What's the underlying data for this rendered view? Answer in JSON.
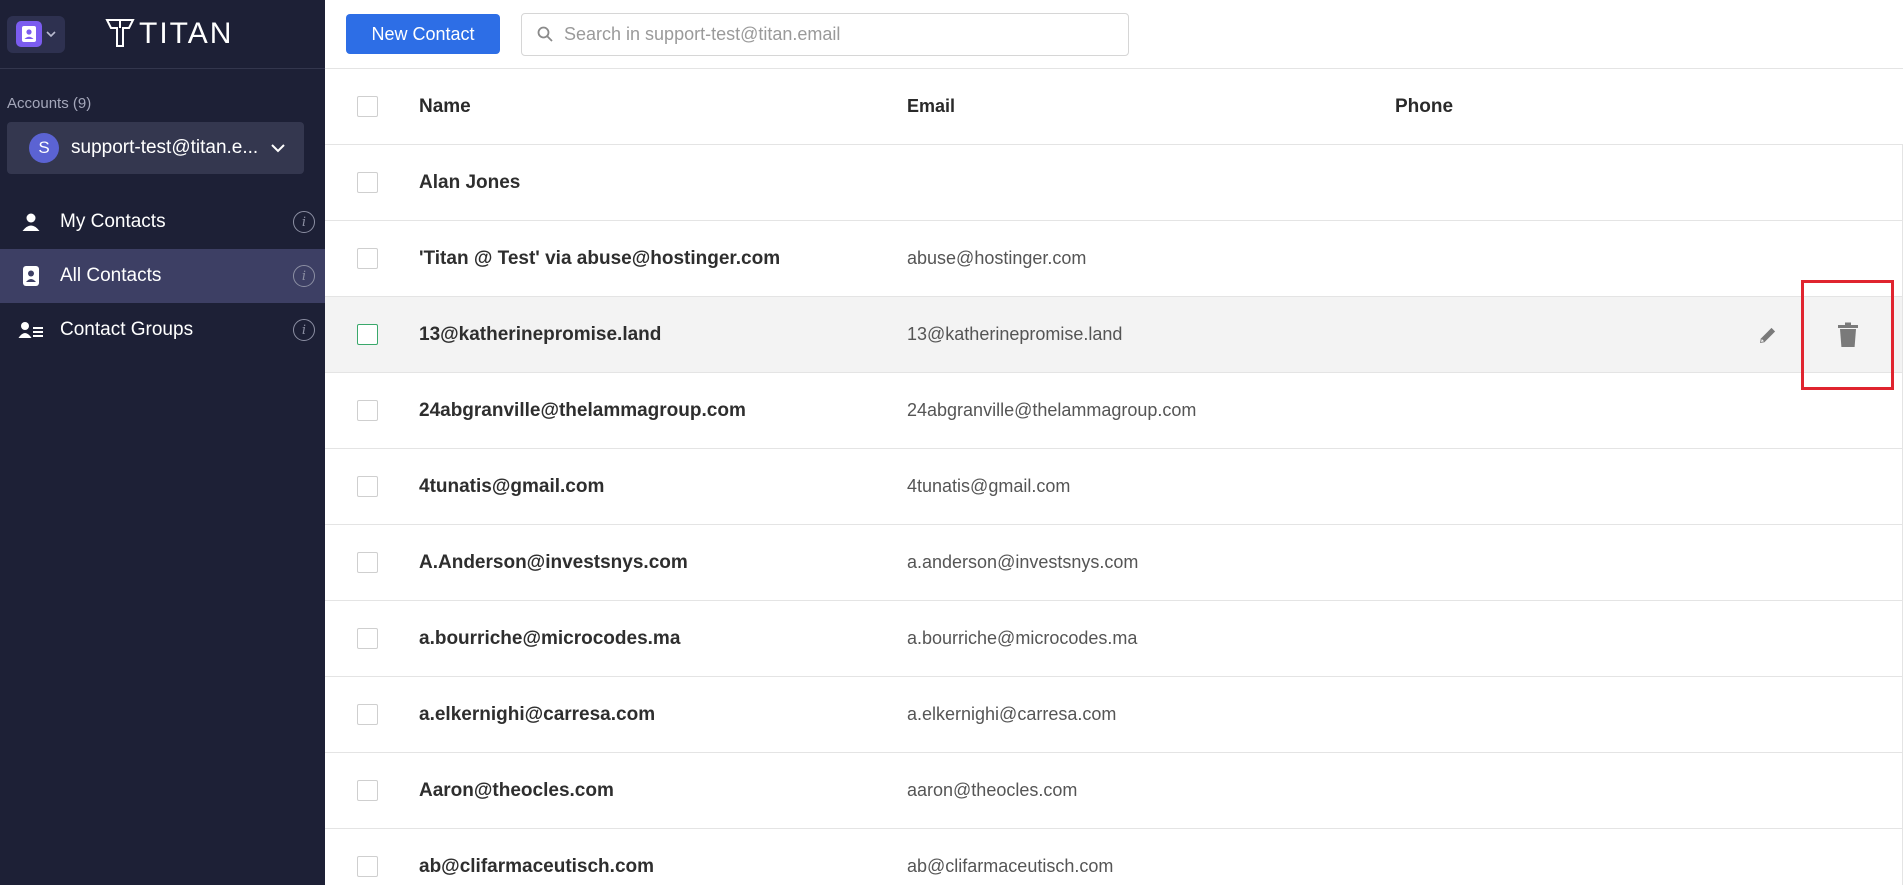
{
  "app": {
    "logo_text": "TITAN"
  },
  "sidebar": {
    "accounts_label": "Accounts (9)",
    "account": {
      "avatar_letter": "S",
      "email": "support-test@titan.e..."
    },
    "items": [
      {
        "label": "My Contacts",
        "icon": "person-icon",
        "active": false
      },
      {
        "label": "All Contacts",
        "icon": "contact-card-icon",
        "active": true
      },
      {
        "label": "Contact Groups",
        "icon": "group-list-icon",
        "active": false
      }
    ]
  },
  "toolbar": {
    "new_contact_label": "New Contact",
    "search_placeholder": "Search in support-test@titan.email"
  },
  "table": {
    "headers": {
      "name": "Name",
      "email": "Email",
      "phone": "Phone"
    },
    "rows": [
      {
        "name": "Alan Jones",
        "email": "",
        "phone": ""
      },
      {
        "name": "'Titan @ Test' via abuse@hostinger.com",
        "email": "abuse@hostinger.com",
        "phone": ""
      },
      {
        "name": "13@katherinepromise.land",
        "email": "13@katherinepromise.land",
        "phone": ""
      },
      {
        "name": "24abgranville@thelammagroup.com",
        "email": "24abgranville@thelammagroup.com",
        "phone": ""
      },
      {
        "name": "4tunatis@gmail.com",
        "email": "4tunatis@gmail.com",
        "phone": ""
      },
      {
        "name": "A.Anderson@investsnys.com",
        "email": "a.anderson@investsnys.com",
        "phone": ""
      },
      {
        "name": "a.bourriche@microcodes.ma",
        "email": "a.bourriche@microcodes.ma",
        "phone": ""
      },
      {
        "name": "a.elkernighi@carresa.com",
        "email": "a.elkernighi@carresa.com",
        "phone": ""
      },
      {
        "name": "Aaron@theocles.com",
        "email": "aaron@theocles.com",
        "phone": ""
      },
      {
        "name": "ab@clifarmaceutisch.com",
        "email": "ab@clifarmaceutisch.com",
        "phone": ""
      }
    ]
  },
  "colors": {
    "sidebar_bg": "#1d2036",
    "active_item_bg": "#3d3f64",
    "primary_button": "#2d6ee6",
    "highlight_box": "#e0242f"
  }
}
